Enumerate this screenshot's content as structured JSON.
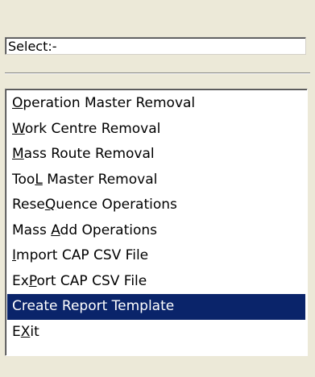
{
  "select": {
    "value": "Select:-"
  },
  "menu": {
    "items": [
      {
        "pre": "",
        "mn": "O",
        "post": "peration Master Removal",
        "selected": false
      },
      {
        "pre": "",
        "mn": "W",
        "post": "ork Centre Removal",
        "selected": false
      },
      {
        "pre": "",
        "mn": "M",
        "post": "ass Route Removal",
        "selected": false
      },
      {
        "pre": "Too",
        "mn": "L",
        "post": " Master Removal",
        "selected": false
      },
      {
        "pre": "Rese",
        "mn": "Q",
        "post": "uence Operations",
        "selected": false
      },
      {
        "pre": "Mass ",
        "mn": "A",
        "post": "dd Operations",
        "selected": false
      },
      {
        "pre": "",
        "mn": "I",
        "post": "mport CAP CSV File",
        "selected": false
      },
      {
        "pre": "Ex",
        "mn": "P",
        "post": "ort CAP CSV File",
        "selected": false
      },
      {
        "pre": "Create Report Template",
        "mn": "",
        "post": "",
        "selected": true
      },
      {
        "pre": "E",
        "mn": "X",
        "post": "it",
        "selected": false
      }
    ]
  },
  "colors": {
    "selection": "#0a246a",
    "face": "#ece9d8"
  }
}
